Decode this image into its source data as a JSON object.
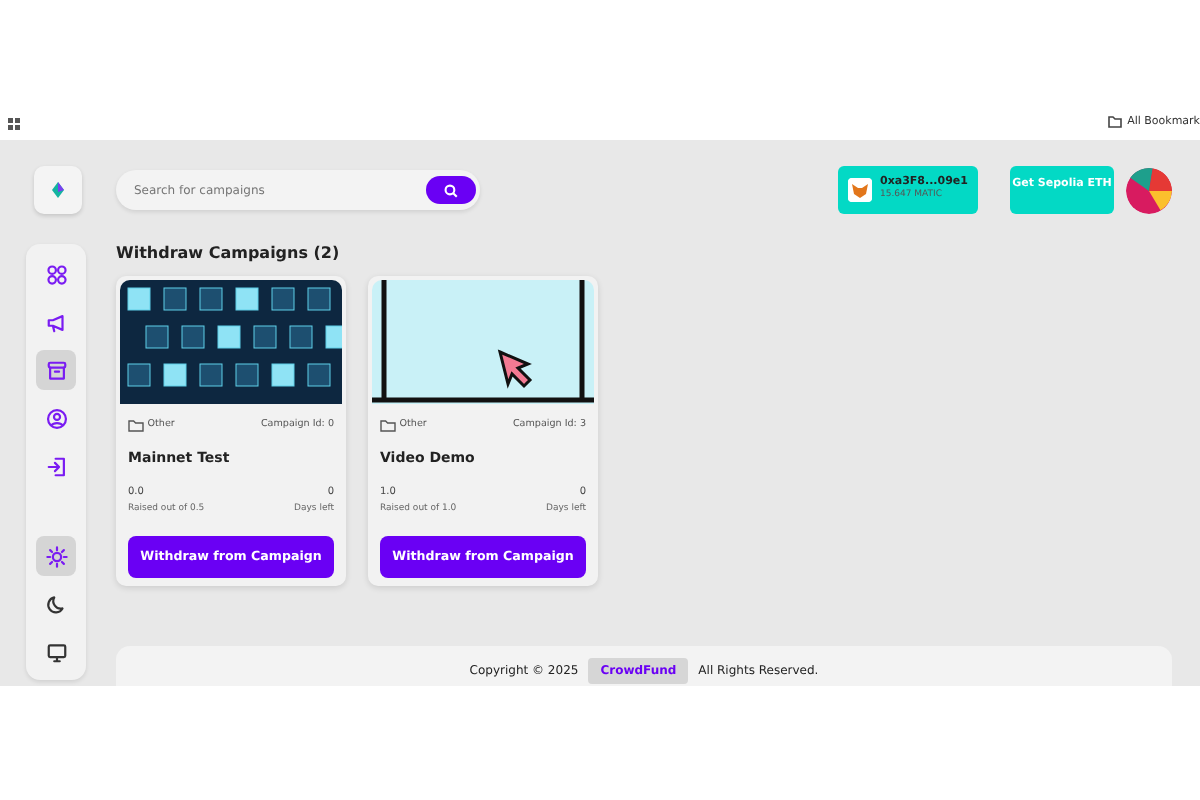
{
  "browser_bar": {
    "bookmarks_label": "All Bookmark"
  },
  "search": {
    "placeholder": "Search for campaigns"
  },
  "wallet": {
    "address": "0xa3F8...09e1",
    "balance": "15.647 MATIC"
  },
  "faucet_button": "Get Sepolia ETH",
  "sidebar": {
    "nav": [
      {
        "kind": "grid",
        "selected": false
      },
      {
        "kind": "megaphone",
        "selected": false
      },
      {
        "kind": "archive",
        "selected": true
      },
      {
        "kind": "user",
        "selected": false
      },
      {
        "kind": "login",
        "selected": false
      }
    ],
    "themes": [
      {
        "kind": "sun",
        "selected": true
      },
      {
        "kind": "moon",
        "selected": false
      },
      {
        "kind": "monitor",
        "selected": false
      }
    ]
  },
  "page_title": "Withdraw Campaigns (2)",
  "campaigns": [
    {
      "kind": "blockchain",
      "category": "Other",
      "campaign_id": "Campaign Id: 0",
      "title": "Mainnet Test",
      "raised": "0.0",
      "raised_label": "Raised out of 0.5",
      "days": "0",
      "days_label": "Days left",
      "button": "Withdraw from Campaign"
    },
    {
      "kind": "demo",
      "category": "Other",
      "campaign_id": "Campaign Id: 3",
      "title": "Video Demo",
      "raised": "1.0",
      "raised_label": "Raised out of 1.0",
      "days": "0",
      "days_label": "Days left",
      "button": "Withdraw from Campaign"
    }
  ],
  "footer": {
    "copyright": "Copyright © 2025",
    "brand": "CrowdFund",
    "rights": "All Rights Reserved."
  }
}
